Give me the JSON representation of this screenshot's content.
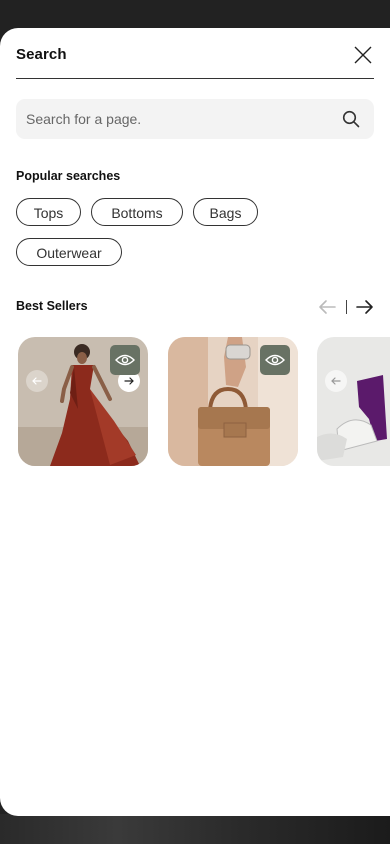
{
  "sheet": {
    "title": "Search"
  },
  "search": {
    "placeholder": "Search for a page."
  },
  "popular": {
    "title": "Popular searches",
    "chips": [
      "Tops",
      "Bottoms",
      "Bags",
      "Outerwear"
    ]
  },
  "best_sellers": {
    "title": "Best Sellers",
    "products": [
      {
        "image": "woman in red gown"
      },
      {
        "image": "hand holding tan leather bag"
      },
      {
        "image": "purple shoes on white"
      }
    ]
  },
  "icons": {
    "close": "close-icon",
    "search": "search-icon",
    "prev": "arrow-left-icon",
    "next": "arrow-right-icon",
    "quick_view": "eye-icon"
  },
  "colors": {
    "quick_view_bg": "#687264",
    "text": "#111111"
  }
}
